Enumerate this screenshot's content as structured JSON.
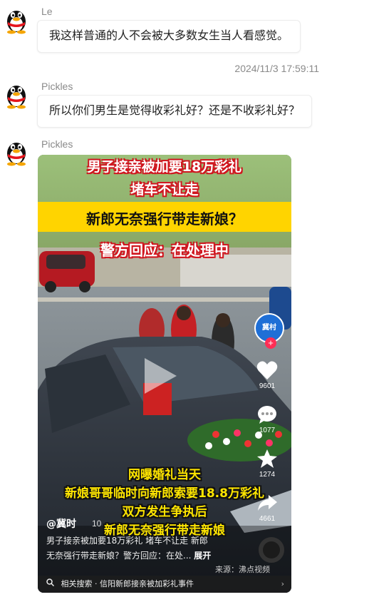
{
  "messages": [
    {
      "sender": "Le",
      "text": "我这样普通的人不会被大多数女生当人看感觉。"
    },
    {
      "sender": "Pickles",
      "text": "所以你们男生是觉得收彩礼好？还是不收彩礼好？"
    },
    {
      "sender": "Pickles"
    }
  ],
  "timestamp": "2024/11/3 17:59:11",
  "video": {
    "headline_1": "男子接亲被加要18万彩礼",
    "headline_2": "堵车不让走",
    "headline_3": "新郎无奈强行带走新娘？",
    "headline_4": "警方回应：在处理中",
    "subtitle_1": "网曝婚礼当天",
    "subtitle_2": "新娘哥哥临时向新郎索要18.8万彩礼",
    "subtitle_3": "双方发生争执后",
    "subtitle_4": "新郎无奈强行带走新娘",
    "account": "@冀时",
    "caption_1": "男子接亲被加要18万彩礼 堵车不让走 新郎",
    "caption_2": "无奈强行带走新娘？警方回应：在处...",
    "expand": "展开",
    "source": "来源：沸点视频",
    "live_badge": "冀村",
    "like_count": "9601",
    "comment_count": "1077",
    "fav_count": "1274",
    "share_count": "4661",
    "related_search": "相关搜索 · 信阳新郎接亲被加彩礼事件",
    "partial_num": "10"
  },
  "colors": {
    "banner_yellow": "#ffd400",
    "subtitle_yellow": "#ffe600",
    "headline_red": "#e8202a"
  }
}
